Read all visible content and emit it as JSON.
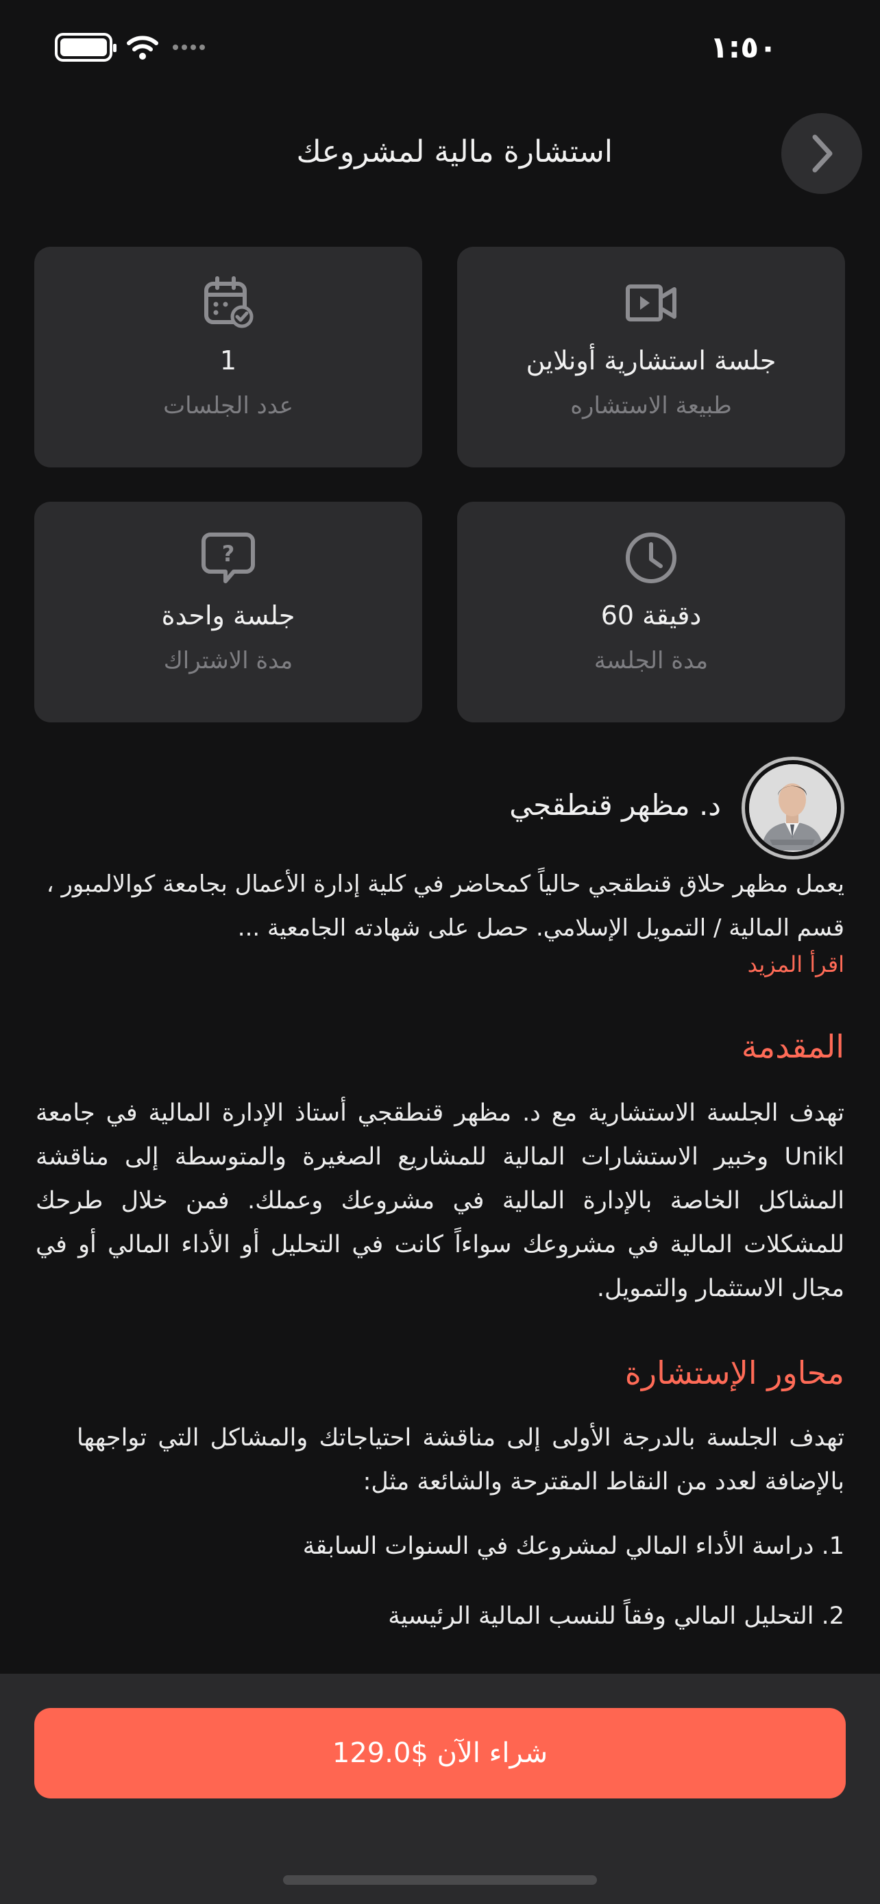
{
  "status_bar": {
    "time": "١:٥٠"
  },
  "header": {
    "title": "استشارة مالية لمشروعك"
  },
  "info_cards": [
    {
      "icon": "video-camera-icon",
      "value": "جلسة استشارية أونلاين",
      "label": "طبيعة الاستشاره"
    },
    {
      "icon": "calendar-check-icon",
      "value": "1",
      "label": "عدد الجلسات"
    },
    {
      "icon": "clock-icon",
      "value": "دقيقة 60",
      "label": "مدة الجلسة"
    },
    {
      "icon": "question-bubble-icon",
      "value": "جلسة واحدة",
      "label": "مدة الاشتراك"
    }
  ],
  "instructor": {
    "name": "د. مظهر قنطقجي",
    "bio": "يعمل مظهر حلاق قنطقجي حالياً كمحاضر في كلية إدارة الأعمال بجامعة كوالالمبور ، قسم المالية / التمويل الإسلامي. حصل على شهادته الجامعية ...",
    "read_more": "اقرأ المزيد"
  },
  "intro": {
    "title": "المقدمة",
    "text": "تهدف الجلسة الاستشارية مع د. مظهر قنطقجي أستاذ الإدارة المالية في جامعة Unikl وخبير الاستشارات المالية للمشاريع الصغيرة والمتوسطة إلى مناقشة المشاكل الخاصة بالإدارة المالية في مشروعك وعملك. فمن خلال طرحك للمشكلات المالية في مشروعك سواءاً كانت في التحليل أو الأداء المالي أو في مجال الاستثمار والتمويل."
  },
  "axes": {
    "title": "محاور الإستشارة",
    "text": "تهدف الجلسة بالدرجة الأولى إلى مناقشة احتياجاتك والمشاكل التي تواجهها بالإضافة لعدد من النقاط المقترحة والشائعة مثل:",
    "items": [
      "1. دراسة الأداء المالي لمشروعك في السنوات السابقة",
      "2. التحليل المالي وفقاً للنسب المالية الرئيسية"
    ]
  },
  "buy_button": {
    "label": "شراء الآن $129.0"
  },
  "colors": {
    "accent": "#ff6651",
    "card": "#2c2c2e",
    "background": "#121213"
  }
}
